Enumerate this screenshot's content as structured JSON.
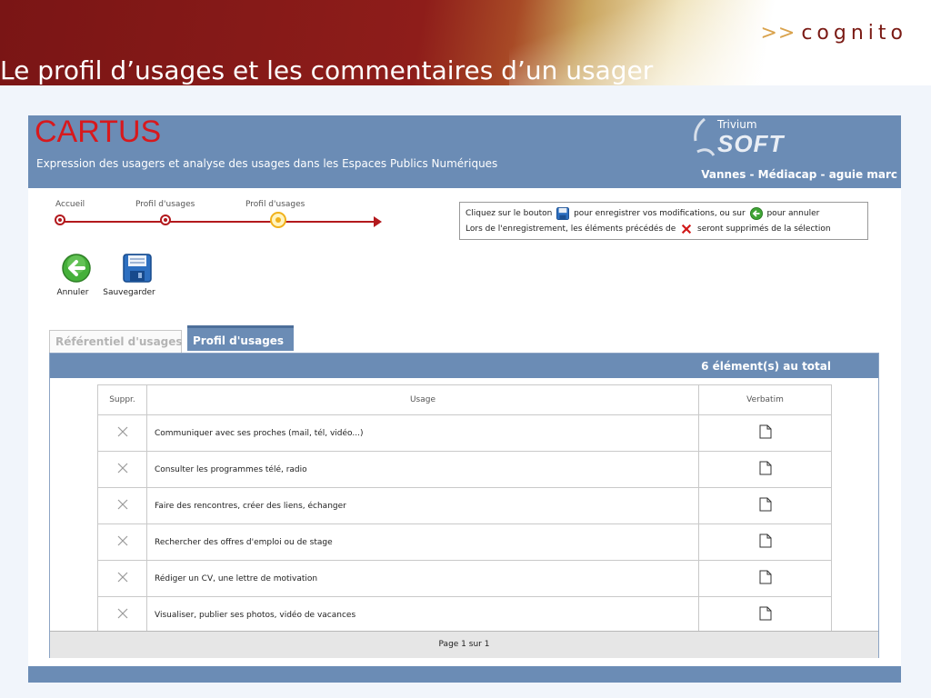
{
  "slide": {
    "title": "Le profil d’usages et les commentaires d’un usager",
    "brand_arrows": ">>",
    "brand": "cognito"
  },
  "app": {
    "logo": "CARTUS",
    "tagline": "Expression des usagers et analyse des usages dans les Espaces Publics Numériques",
    "partner_top": "Trivium",
    "partner_main": "SOFT",
    "user_info": "Vannes - Médiacap - aguie marc",
    "colors": {
      "banner": "#6b8cb5",
      "logo": "#d7191d",
      "timeline": "#b3191d",
      "active_step": "#f1b21c"
    }
  },
  "breadcrumb": {
    "steps": [
      {
        "label": "Accueil",
        "state": "done"
      },
      {
        "label": "Profil d'usages",
        "state": "done"
      },
      {
        "label": "Profil d'usages",
        "state": "current"
      }
    ]
  },
  "help": {
    "line1_a": "Cliquez sur le bouton",
    "line1_b": "pour enregistrer vos modifications, ou sur",
    "line1_c": "pour annuler",
    "line2_a": "Lors de l'enregistrement, les éléments précédés de",
    "line2_b": "seront supprimés de la sélection",
    "icons": [
      "save-icon",
      "back-arrow-icon",
      "delete-x-icon"
    ]
  },
  "toolbar": {
    "cancel_label": "Annuler",
    "save_label": "Sauvegarder"
  },
  "tabs": [
    {
      "label": "Référentiel d'usages",
      "active": false
    },
    {
      "label": "Profil d'usages",
      "active": true
    }
  ],
  "panel": {
    "total": "6  élément(s) au total",
    "columns": {
      "suppr": "Suppr.",
      "usage": "Usage",
      "verbatim": "Verbatim"
    },
    "rows": [
      {
        "usage": "Communiquer avec ses proches (mail, tél, vidéo...)"
      },
      {
        "usage": "Consulter les programmes télé, radio"
      },
      {
        "usage": "Faire des rencontres, créer des liens, échanger"
      },
      {
        "usage": "Rechercher des offres d'emploi ou de stage"
      },
      {
        "usage": "Rédiger un CV, une lettre de motivation"
      },
      {
        "usage": "Visualiser, publier ses photos, vidéo de vacances"
      }
    ],
    "pager": "Page 1 sur 1"
  }
}
